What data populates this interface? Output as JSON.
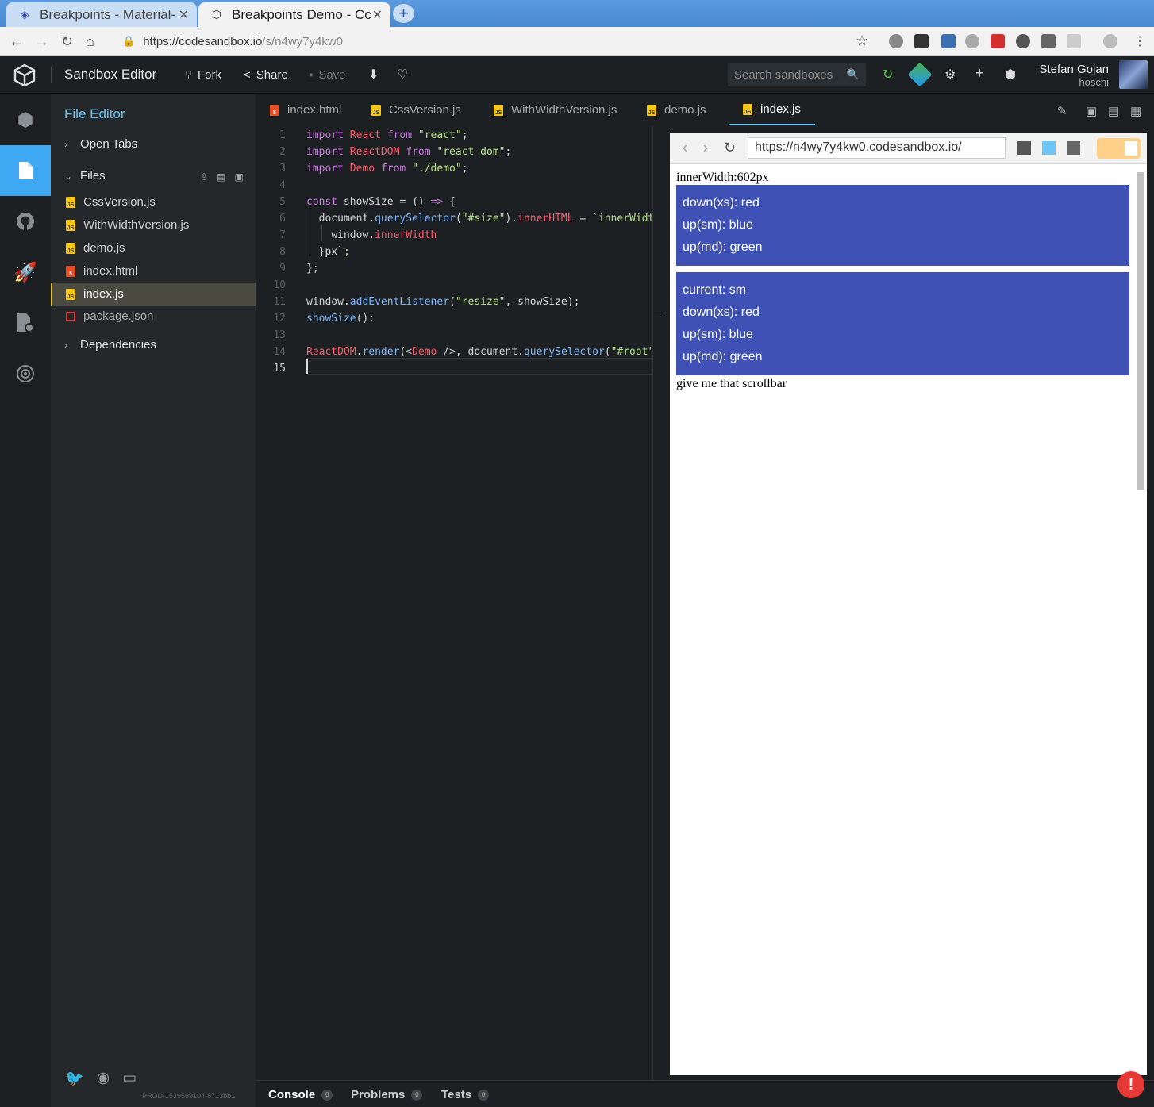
{
  "browser": {
    "tabs": [
      {
        "title": "Breakpoints - Material-"
      },
      {
        "title": "Breakpoints Demo - Cc"
      }
    ],
    "url_host": "https://codesandbox.io",
    "url_path": "/s/n4wy7y4kw0"
  },
  "topbar": {
    "title": "Sandbox Editor",
    "fork": "Fork",
    "share": "Share",
    "save": "Save",
    "search_placeholder": "Search sandboxes",
    "user_name": "Stefan Gojan",
    "user_handle": "hoschi"
  },
  "sidebar": {
    "title": "File Editor",
    "open_tabs": "Open Tabs",
    "files_label": "Files",
    "dependencies": "Dependencies",
    "files": [
      {
        "name": "CssVersion.js",
        "type": "js"
      },
      {
        "name": "WithWidthVersion.js",
        "type": "js"
      },
      {
        "name": "demo.js",
        "type": "js"
      },
      {
        "name": "index.html",
        "type": "html"
      },
      {
        "name": "index.js",
        "type": "js"
      },
      {
        "name": "package.json",
        "type": "json"
      }
    ],
    "selected_file": "index.js",
    "build": "PROD-1539599104-8713bb1"
  },
  "editor_tabs": [
    {
      "name": "index.html",
      "type": "html"
    },
    {
      "name": "CssVersion.js",
      "type": "js"
    },
    {
      "name": "WithWidthVersion.js",
      "type": "js"
    },
    {
      "name": "demo.js",
      "type": "js"
    },
    {
      "name": "index.js",
      "type": "js"
    }
  ],
  "code": {
    "line_numbers": [
      "1",
      "2",
      "3",
      "4",
      "5",
      "6",
      "7",
      "8",
      "9",
      "10",
      "11",
      "12",
      "13",
      "14",
      "15"
    ],
    "lines": [
      "import React from \"react\";",
      "import ReactDOM from \"react-dom\";",
      "import Demo from \"./demo\";",
      "",
      "const showSize = () => {",
      "  document.querySelector(\"#size\").innerHTML = `innerWidth:$",
      "    window.innerWidth",
      "  }px`;",
      "};",
      "",
      "window.addEventListener(\"resize\", showSize);",
      "showSize();",
      "",
      "ReactDOM.render(<Demo />, document.querySelector(\"#root\"))",
      ""
    ]
  },
  "preview": {
    "url": "https://n4wy7y4kw0.codesandbox.io/",
    "inner_width": "innerWidth:602px",
    "box1": [
      "down(xs): red",
      "up(sm): blue",
      "up(md): green"
    ],
    "box2": [
      "current: sm",
      "down(xs): red",
      "up(sm): blue",
      "up(md): green"
    ],
    "footer_text": "give me that scrollbar",
    "box_color": "#3f51b5"
  },
  "bottom_tabs": [
    {
      "label": "Console",
      "count": "0"
    },
    {
      "label": "Problems",
      "count": "0"
    },
    {
      "label": "Tests",
      "count": "0"
    }
  ]
}
